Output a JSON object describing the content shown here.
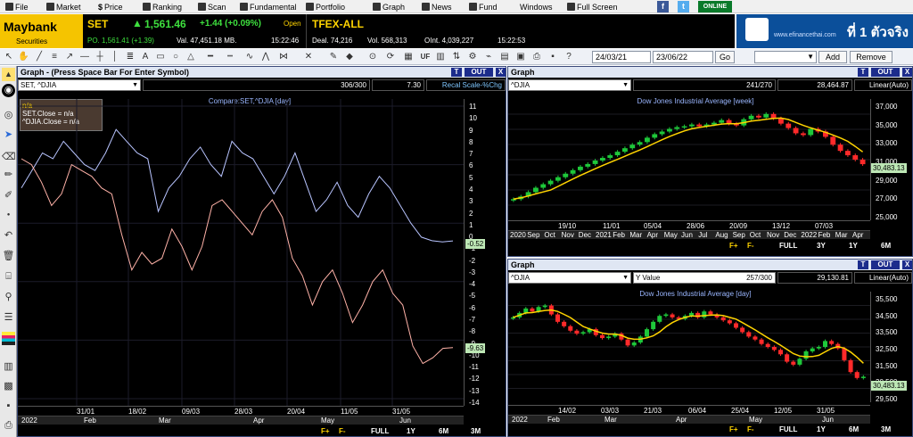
{
  "menu": {
    "items": [
      "File",
      "Market",
      "Price",
      "Ranking",
      "Scan",
      "Fundamental",
      "Portfolio",
      "Graph",
      "News",
      "Fund",
      "Windows",
      "Full Screen"
    ],
    "online": "ONLINE"
  },
  "quote": {
    "brand": "Maybank",
    "brand_sub": "Securities",
    "symbol": "SET",
    "price": "1,561.46",
    "change": "+1.44 (+0.09%)",
    "status": "Open",
    "prev": "PO. 1,561.41 (+1.39)",
    "value": "Val. 47,451.18 MB.",
    "time1": "15:22:46",
    "tfex": "TFEX-ALL",
    "deal": "Deal. 74,216",
    "vol": "Vol. 568,313",
    "oint": "OInt. 4,039,227",
    "time2": "15:22:53"
  },
  "ad": {
    "text": "ที่ 1 ตัวจริง",
    "small": "www.efinancethai.com"
  },
  "toolbar": {
    "date_from": "24/03/21",
    "date_to": "23/06/22",
    "go": "Go",
    "add": "Add",
    "remove": "Remove",
    "uf": "UF"
  },
  "left_panel": {
    "title": "Graph - (Press Space Bar For Enter Symbol)",
    "out": "OUT",
    "t": "T",
    "x": "X",
    "symbol": "SET, ^DJIA",
    "count": "306/300",
    "value": "7.30",
    "scale": "Recal Scale-%Chg",
    "subtitle": "Compare:SET,^DJIA [day]",
    "legend": {
      "title": "n/a",
      "line1": "SET.Close  = n/a",
      "line2": "^DJIA.Close  = n/a"
    },
    "y_ticks": [
      "11",
      "10",
      "9",
      "8",
      "7",
      "6",
      "5",
      "4",
      "3",
      "2",
      "1",
      "0",
      "-1",
      "-2",
      "-3",
      "-4",
      "-5",
      "-6",
      "-7",
      "-8",
      "-9",
      "-10",
      "-11",
      "-12",
      "-13",
      "-14"
    ],
    "badge_set": "-0.52",
    "badge_djia": "-9.63",
    "x_dates": [
      "31/01",
      "18/02",
      "09/03",
      "28/03",
      "20/04",
      "11/05",
      "31/05"
    ],
    "x_months": [
      "2022",
      "Feb",
      "Mar",
      "Apr",
      "May",
      "Jun"
    ],
    "buttons": [
      "F+",
      "F-",
      "FULL",
      "1Y",
      "6M",
      "3M"
    ]
  },
  "right_top": {
    "title": "Graph",
    "out": "OUT",
    "t": "T",
    "x": "X",
    "symbol": "^DJIA",
    "count": "241/270",
    "value": "28,464.87",
    "scale": "Linear(Auto)",
    "subtitle": "Dow Jones Industrial Average [week]",
    "y_ticks": [
      "37,000",
      "35,000",
      "33,000",
      "31,000",
      "29,000",
      "27,000",
      "25,000"
    ],
    "badge": "30,483.13",
    "x_dates": [
      "19/10",
      "11/01",
      "05/04",
      "28/06",
      "20/09",
      "13/12",
      "07/03"
    ],
    "x_months": [
      "2020",
      "Sep",
      "Oct",
      "Nov",
      "Dec",
      "2021",
      "Feb",
      "Mar",
      "Apr",
      "May",
      "Jun",
      "Jul",
      "Aug",
      "Sep",
      "Oct",
      "Nov",
      "Dec",
      "2022",
      "Feb",
      "Mar",
      "Apr"
    ],
    "buttons": [
      "F+",
      "F-",
      "FULL",
      "3Y",
      "1Y",
      "6M"
    ]
  },
  "right_bottom": {
    "title": "Graph",
    "out": "OUT",
    "t": "T",
    "x": "X",
    "symbol": "^DJIA",
    "yvalue": "Y Value",
    "count": "257/300",
    "value": "29,130.81",
    "scale": "Linear(Auto)",
    "subtitle": "Dow Jones Industrial Average [day]",
    "y_ticks": [
      "35,500",
      "34,500",
      "33,500",
      "32,500",
      "31,500",
      "30,500",
      "29,500"
    ],
    "badge": "30,483.13",
    "x_dates": [
      "14/02",
      "03/03",
      "21/03",
      "06/04",
      "25/04",
      "12/05",
      "31/05"
    ],
    "x_months": [
      "2022",
      "Feb",
      "Mar",
      "Apr",
      "May",
      "Jun"
    ],
    "buttons": [
      "F+",
      "F-",
      "FULL",
      "1Y",
      "6M",
      "3M"
    ]
  },
  "chart_data": [
    {
      "type": "line",
      "title": "Compare:SET,^DJIA [day]",
      "ylim": [
        -14,
        11
      ],
      "x_axis_labels": [
        "31/01",
        "18/02",
        "09/03",
        "28/03",
        "20/04",
        "11/05",
        "31/05"
      ],
      "series": [
        {
          "name": "SET.Close",
          "color": "#b8c4ff",
          "values": [
            4,
            5.5,
            7,
            6.5,
            8,
            7,
            6,
            5.5,
            7,
            9,
            8,
            7,
            6.5,
            2,
            4,
            5,
            6.5,
            7.5,
            6,
            5,
            8,
            7,
            6.5,
            5,
            3.5,
            5,
            7,
            4.5,
            2,
            3,
            4.5,
            2.5,
            1.5,
            3.5,
            5,
            4,
            2.5,
            1,
            -0.2,
            -0.5,
            -0.6,
            -0.52
          ]
        },
        {
          "name": "^DJIA.Close",
          "color": "#ffb2a8",
          "values": [
            6.5,
            6,
            4.5,
            2.5,
            3.5,
            6,
            5.5,
            5,
            4,
            3.5,
            0,
            -3,
            -1.5,
            -2.5,
            -2,
            0.5,
            -1,
            -3,
            -1,
            2.5,
            3,
            2,
            1,
            0,
            2,
            3,
            1.5,
            -2,
            -3.5,
            -6,
            -4,
            -3,
            -5,
            -7.5,
            -6,
            -4,
            -3,
            -5,
            -6,
            -9.5,
            -11,
            -10.5,
            -9.7,
            -9.63
          ]
        }
      ]
    },
    {
      "type": "candlestick",
      "title": "Dow Jones Industrial Average [week]",
      "ylim": [
        24500,
        37500
      ],
      "series": [
        {
          "name": "^DJIA",
          "values": [
            26500,
            26800,
            27300,
            27800,
            28200,
            28600,
            29000,
            29400,
            29800,
            30200,
            30500,
            30900,
            31200,
            31500,
            31900,
            32300,
            32700,
            33000,
            33500,
            33900,
            34200,
            34500,
            34700,
            34800,
            35000,
            34800,
            35000,
            35200,
            35500,
            35100,
            34900,
            35600,
            36000,
            35800,
            36200,
            35700,
            35100,
            34600,
            34000,
            33800,
            34500,
            34200,
            33600,
            32700,
            32000,
            31500,
            31000,
            30483
          ]
        }
      ]
    },
    {
      "type": "candlestick",
      "title": "Dow Jones Industrial Average [day]",
      "ylim": [
        29000,
        36000
      ],
      "series": [
        {
          "name": "^DJIA",
          "values": [
            34500,
            34800,
            35100,
            34900,
            35200,
            35300,
            34700,
            34200,
            33900,
            33600,
            33400,
            33500,
            33700,
            33300,
            33100,
            33200,
            33400,
            33000,
            32600,
            32800,
            33200,
            33700,
            34200,
            34600,
            34700,
            34500,
            34400,
            34600,
            34800,
            34500,
            34900,
            34700,
            34500,
            34300,
            34100,
            33800,
            33500,
            33200,
            33000,
            32700,
            32500,
            32300,
            32000,
            31500,
            31300,
            31700,
            32200,
            32400,
            32500,
            32900,
            32700,
            32400,
            31600,
            30800,
            30400,
            30483
          ]
        }
      ]
    }
  ]
}
